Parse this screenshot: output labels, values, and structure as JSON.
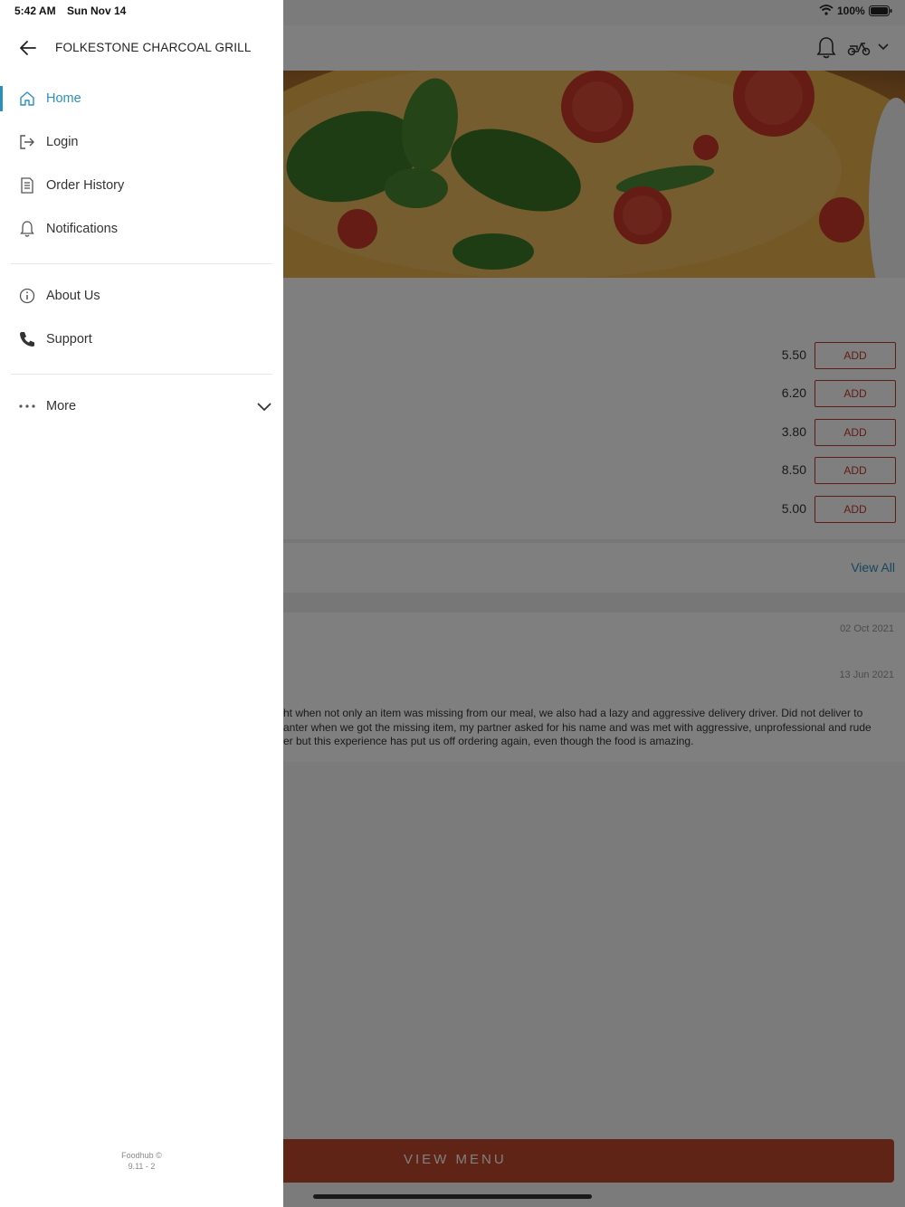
{
  "status_bar": {
    "time": "5:42 AM",
    "date": "Sun Nov 14",
    "battery": "100%"
  },
  "drawer": {
    "restaurant_name": "FOLKESTONE CHARCOAL GRILL",
    "nav_primary": [
      {
        "label": "Home",
        "icon": "home-icon",
        "active": true
      },
      {
        "label": "Login",
        "icon": "login-icon"
      },
      {
        "label": "Order History",
        "icon": "receipt-icon"
      },
      {
        "label": "Notifications",
        "icon": "bell-icon"
      }
    ],
    "nav_secondary": [
      {
        "label": "About Us",
        "icon": "info-icon"
      },
      {
        "label": "Support",
        "icon": "phone-icon"
      }
    ],
    "more": {
      "label": "More",
      "icon": "more-dots-icon"
    },
    "footer_brand": "Foodhub ©",
    "footer_version": "9.11 - 2"
  },
  "background": {
    "items": [
      {
        "price": "5.50",
        "button": "ADD"
      },
      {
        "price": "6.20",
        "button": "ADD"
      },
      {
        "price": "3.80",
        "button": "ADD"
      },
      {
        "price": "8.50",
        "button": "ADD"
      },
      {
        "price": "5.00",
        "button": "ADD"
      }
    ],
    "view_all": "View All",
    "reviews": [
      {
        "date": "02 Oct 2021"
      },
      {
        "date": "13 Jun 2021"
      }
    ],
    "review_text": "ht when not only an item was missing from our meal, we also had a lazy and aggressive delivery driver. Did not deliver to\nanter when we got the missing item, my partner asked for his name and was met with aggressive, unprofessional and rude\ner but this experience has put us off ordering again, even though the food is amazing.",
    "view_menu": "VIEW MENU"
  },
  "colors": {
    "accent": "#2a8fbf",
    "brand": "#c0492f",
    "add_border": "#c0392b"
  }
}
